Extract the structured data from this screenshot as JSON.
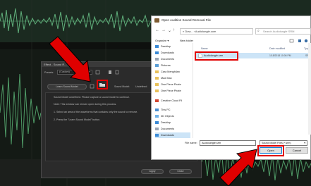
{
  "audition": {
    "time_readout": "bs 1, 61 Ssk L, R"
  },
  "effect_dialog": {
    "title": "Effect - Sound R...",
    "presets_label": "Presets:",
    "preset_value": "(Custom)",
    "learn_button": "Learn Sound Model",
    "sound_model_label": "Sound Model:",
    "sound_model_value": "Undefined",
    "info_lines": [
      "Sound Model undefined. Please capture a sound model to continue.",
      "Note: This window can remain open during this process.",
      "1. Select an area of the waveforms that contains only the sound to remove.",
      "2. Press the \"Learn Sound Model\" button."
    ],
    "apply_button": "Apply",
    "close_button": "Close"
  },
  "file_dialog": {
    "title": "Open Audition Sound Removal File",
    "address": "« Dow... › Audiolungle.com",
    "search_placeholder": "Search Audiolungle SRM",
    "organize": "Organize ▾",
    "new_folder": "New folder",
    "nav_items": [
      {
        "label": "Desktop",
        "icon": "desktop-icon"
      },
      {
        "label": "Downloads",
        "icon": "downloads-icon"
      },
      {
        "label": "Documents",
        "icon": "documents-icon"
      },
      {
        "label": "Pictures",
        "icon": "pictures-icon"
      },
      {
        "label": "Cara Menghilan",
        "icon": "folder-icon"
      },
      {
        "label": "Mad Max",
        "icon": "folder-icon"
      },
      {
        "label": "One Piece Pirate",
        "icon": "folder-icon"
      },
      {
        "label": "One Piece Pirate",
        "icon": "folder-icon"
      },
      {
        "label": "Creative Cloud Fil",
        "icon": "cloud-icon"
      },
      {
        "label": "This PC",
        "icon": "pc-icon"
      },
      {
        "label": "3D Objects",
        "icon": "cube-icon"
      },
      {
        "label": "Desktop",
        "icon": "desktop-icon"
      },
      {
        "label": "Documents",
        "icon": "documents-icon"
      },
      {
        "label": "Downloads",
        "icon": "downloads-icon"
      }
    ],
    "columns": {
      "name": "Name",
      "date": "Date modified",
      "type": "Typ"
    },
    "file": {
      "name": "Audiolungle.srm",
      "date": "1/18/2018 10:06 PM",
      "type": "SR"
    },
    "filename_label": "File name:",
    "filename_value": "Audiolungle.srm",
    "filetype_value": "Sound Model Files (*.srm)",
    "open_button": "Open",
    "cancel_button": "Cancel"
  },
  "colors": {
    "annotation_red": "#e00000",
    "waveform_green": "#5fae7a",
    "selection_blue": "#cce4f7"
  }
}
